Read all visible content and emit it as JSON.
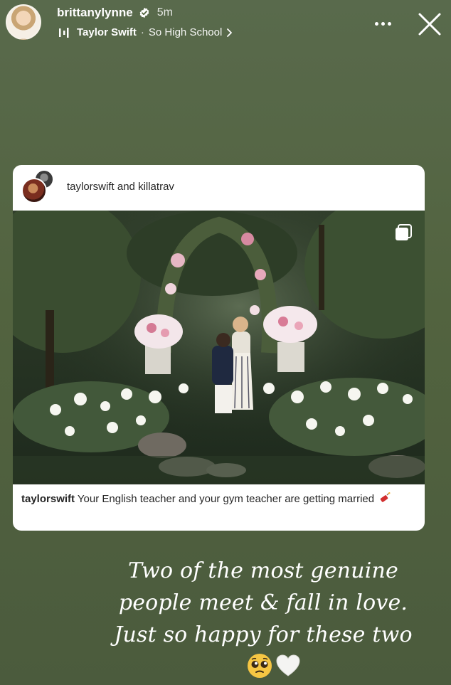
{
  "story": {
    "username": "brittanylynne",
    "time_ago": "5m",
    "music": {
      "artist": "Taylor Swift",
      "separator": "·",
      "song": "So High School"
    },
    "overlay_text_lines": [
      "Two of the most genuine",
      "people meet & fall in love.",
      "Just so happy for these two"
    ],
    "emojis": [
      "pleading-face-icon",
      "white-heart-icon"
    ]
  },
  "post": {
    "author_primary": "taylorswift",
    "author_joiner": "and",
    "author_secondary": "killatrav",
    "caption_user": "taylorswift",
    "caption_text": "Your English teacher and your gym teacher are getting married",
    "caption_emoji": "firecracker-icon"
  },
  "icons": {
    "verified": "verified-badge-icon",
    "music": "music-bars-icon",
    "more": "more-dots-icon",
    "close": "close-icon",
    "multi_photo": "multiple-photos-icon"
  },
  "colors": {
    "background": "#52633f",
    "card": "#ffffff",
    "verified_blue": "#ffffff",
    "text_dark": "#262626"
  }
}
